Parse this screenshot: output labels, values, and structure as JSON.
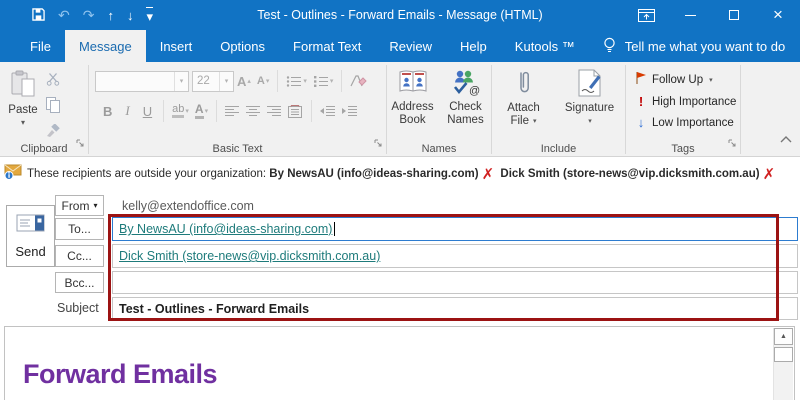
{
  "glyphs": {
    "undo": "↶",
    "redo": "↷",
    "up_arrow": "↑",
    "down_arrow": "↓",
    "caret_down": "▾",
    "caret_up": "▴",
    "close": "×",
    "scroll_up": "▲",
    "x_mark": "✗",
    "exclamation": "!",
    "low_arrow": "↓"
  },
  "titlebar": {
    "title": "Test - Outlines - Forward Emails - Message (HTML)"
  },
  "tabs": {
    "file": "File",
    "message": "Message",
    "insert": "Insert",
    "options": "Options",
    "format_text": "Format Text",
    "review": "Review",
    "help": "Help",
    "kutools": "Kutools ™",
    "tell_me": "Tell me what you want to do"
  },
  "ribbon": {
    "clipboard": {
      "paste": "Paste",
      "label": "Clipboard"
    },
    "basic_text": {
      "font_size": "22",
      "bold": "B",
      "italic": "I",
      "underline": "U",
      "highlight": "ab",
      "font_color": "A",
      "label": "Basic Text"
    },
    "names": {
      "address_line1": "Address",
      "address_line2": "Book",
      "check_line1": "Check",
      "check_line2": "Names",
      "label": "Names"
    },
    "include": {
      "attach_line1": "Attach",
      "attach_line2": "File",
      "signature": "Signature",
      "label": "Include"
    },
    "tags": {
      "follow_up": "Follow Up",
      "high_importance": "High Importance",
      "low_importance": "Low Importance",
      "label": "Tags"
    }
  },
  "infobar": {
    "message": "These recipients are outside your organization:",
    "recipient1": "By NewsAU (info@ideas-sharing.com)",
    "recipient2": "Dick Smith (store-news@vip.dicksmith.com.au)"
  },
  "form": {
    "send": "Send",
    "from_label": "From",
    "from_value": "kelly@extendoffice.com",
    "to_label": "To...",
    "to_value": "By NewsAU (info@ideas-sharing.com)",
    "cc_label": "Cc...",
    "cc_value": "Dick Smith (store-news@vip.dicksmith.com.au)",
    "bcc_label": "Bcc...",
    "subject_label": "Subject",
    "subject_value": "Test - Outlines - Forward Emails"
  },
  "body": {
    "heading": "Forward Emails"
  },
  "colors": {
    "titlebar_blue": "#1173c4",
    "selected_tab_text": "#1a6bb0",
    "link_teal": "#1e7b7b",
    "annotation_red": "#9c1313",
    "heading_purple": "#7030a0",
    "flag_red": "#d83b01",
    "high_importance_red": "#c00000",
    "low_importance_blue": "#2b6cd4"
  }
}
